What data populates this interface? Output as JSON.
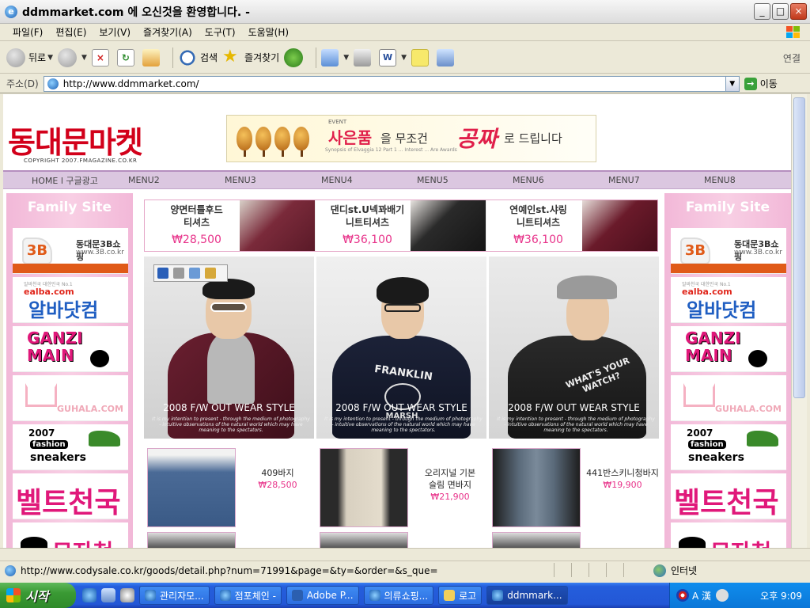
{
  "window": {
    "title": "ddmmarket.com 에 오신것을 환영합니다. -",
    "min_label": "_",
    "max_label": "□",
    "close_label": "×"
  },
  "menubar": [
    "파일(F)",
    "편집(E)",
    "보기(V)",
    "즐겨찾기(A)",
    "도구(T)",
    "도움말(H)"
  ],
  "toolbar": {
    "back": "뒤로",
    "search": "검색",
    "favorites": "즐겨찾기",
    "links": "연결"
  },
  "address": {
    "label": "주소(D)",
    "url": "http://www.ddmmarket.com/",
    "go": "이동"
  },
  "site": {
    "logo": "동대문마켓",
    "logo_sub": "COPYRIGHT 2007.FMAGAZINE.CO.KR",
    "banner": {
      "event": "EVENT",
      "main": "사은품",
      "mid": "을  무조건",
      "free": "공짜",
      "end": "로 드립니다",
      "small": "Synopsis of Elvaggia 12 Part 1 ... Interest ... Are Awards"
    },
    "nav": [
      "HOME l 구글광고",
      "MENU2",
      "MENU3",
      "MENU4",
      "MENU5",
      "MENU6",
      "MENU7",
      "MENU8"
    ],
    "family_site": "Family Site",
    "side_ads": {
      "b3_logo": "3B",
      "b3_name": "동대문3B쇼핑",
      "b3_url": "www.3B.co.kr",
      "alba_top": "알바천국 대한민국 No.1",
      "alba_e": "ealba.com",
      "alba_name": "알바닷컴",
      "ganzi": "GANZI MAIN",
      "guhala": "GUHALA.COM",
      "sneak_year": "2007",
      "sneak_fashion": "fashion",
      "sneak_name": "sneakers",
      "belt": "벨트천국",
      "hat": "모자천국"
    },
    "top_products": [
      {
        "name": "양면터틀후드\n티셔츠",
        "price": "₩28,500"
      },
      {
        "name": "댄디st.U넥꽈배기\n니트티셔츠",
        "price": "₩36,100"
      },
      {
        "name": "연예인st.샤링\n니트티셔츠",
        "price": "₩36,100"
      }
    ],
    "big_products": [
      {
        "caption": "2008 F/W OUT WEAR STYLE",
        "small": "It is my intention to present - through the medium of photography - intuitive observations of the natural world which may have meaning to the spectators."
      },
      {
        "caption": "2008 F/W OUT WEAR STYLE",
        "small": "It is my intention to present - through the medium of photography - intuitive observations of the natural world which may have meaning to the spectators."
      },
      {
        "caption": "2008 F/W OUT WEAR STYLE",
        "small": "It is my intention to present - through the medium of photography - intuitive observations of the natural world which may have meaning to the spectators."
      }
    ],
    "shirt_texts": [
      "FRANKLIN",
      "MARSH",
      "WHAT'S YOUR WATCH?"
    ],
    "small_products": [
      {
        "name": "409바지",
        "price": "₩28,500"
      },
      {
        "name": "오리지널 기본\n슬림 면바지",
        "price": "₩21,900"
      },
      {
        "name": "441반스키니청바지",
        "price": "₩19,900"
      }
    ]
  },
  "status": {
    "url": "http://www.codysale.co.kr/goods/detail.php?num=71991&page=&ty=&order=&s_que=",
    "zone": "인터넷"
  },
  "taskbar": {
    "start": "시작",
    "tasks": [
      "관리자모...",
      "점포체인 -",
      "Adobe P...",
      "의류쇼핑...",
      "로고",
      "ddmmark..."
    ],
    "ime": "A 漢",
    "clock": "오후 9:09"
  }
}
